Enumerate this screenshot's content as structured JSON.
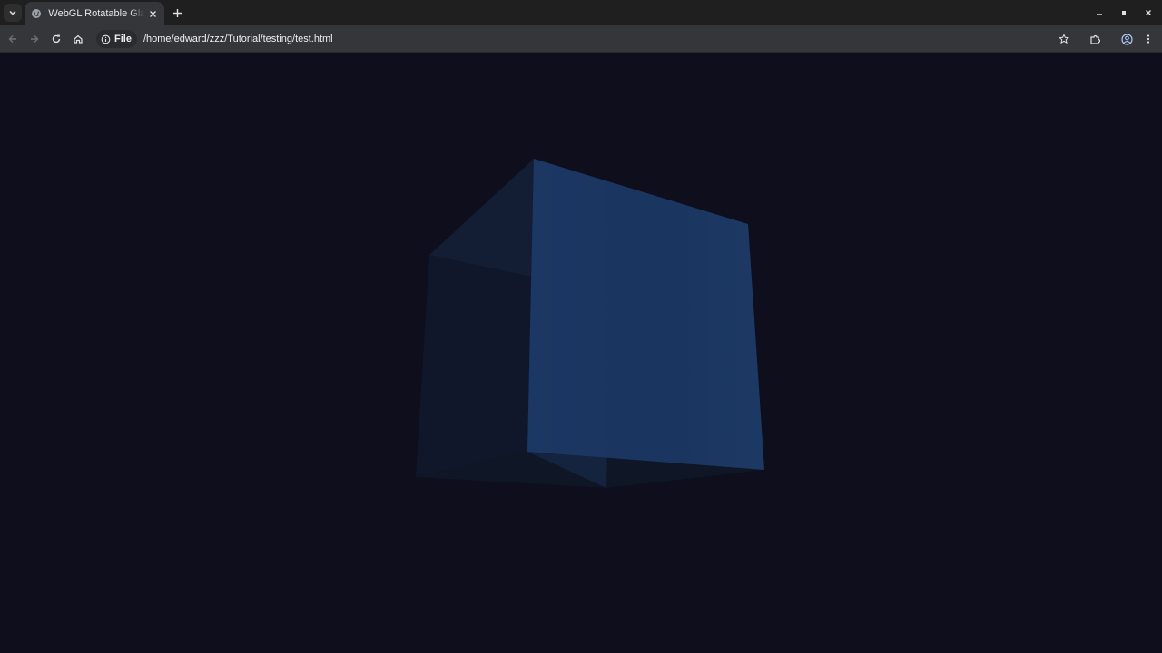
{
  "browser": {
    "tab": {
      "title": "WebGL Rotatable Glass",
      "favicon": "globe-icon",
      "close_icon": "close-icon"
    },
    "tab_search_icon": "chevron-down-icon",
    "new_tab_icon": "plus-icon",
    "window_controls": [
      "minimize-icon",
      "maximize-icon",
      "close-icon"
    ],
    "nav": [
      "back-arrow-icon",
      "forward-arrow-icon",
      "reload-icon",
      "home-icon"
    ],
    "omnibox": {
      "site_info_icon": "info-icon",
      "scheme_label": "File",
      "url": "/home/edward/zzz/Tutorial/testing/test.html",
      "bookmark_icon": "star-icon"
    },
    "toolbar_right": [
      "extensions-icon",
      "profile-icon",
      "menu-dots-icon"
    ]
  },
  "scene": {
    "background": "#0e0e1c",
    "object": "cube",
    "colors": {
      "front_face": "#1b365f",
      "side_face": "#101728",
      "top_face": "#131c33",
      "inner_edge": "#1a2a48"
    }
  }
}
